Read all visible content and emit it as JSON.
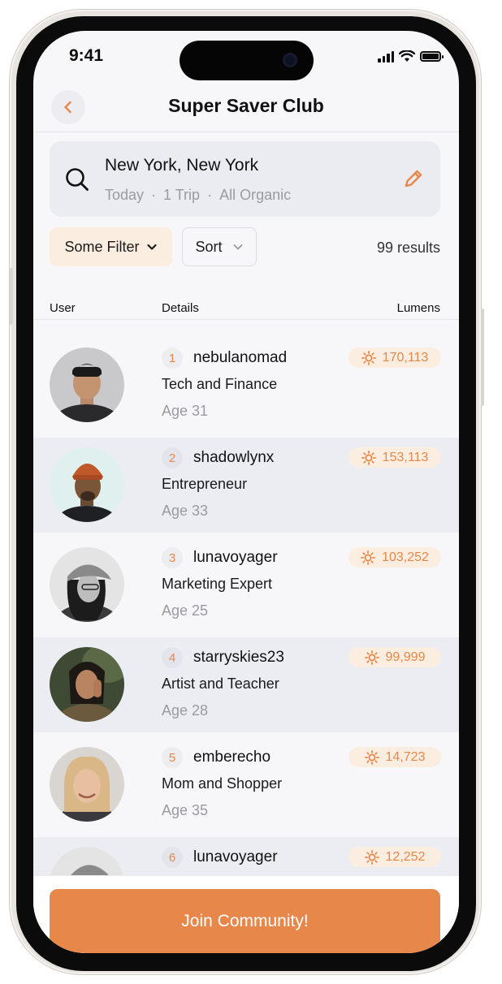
{
  "status_bar": {
    "time": "9:41"
  },
  "header": {
    "title": "Super Saver Club"
  },
  "search": {
    "location": "New York, New York",
    "meta": [
      "Today",
      "1 Trip",
      "All Organic"
    ]
  },
  "filters": {
    "filter_label": "Some Filter",
    "sort_label": "Sort",
    "results": "99 results"
  },
  "columns": {
    "user": "User",
    "details": "Details",
    "lumens": "Lumens"
  },
  "users": [
    {
      "rank": "1",
      "username": "nebulanomad",
      "details": "Tech and Finance",
      "age": "Age 31",
      "lumens": "170,113"
    },
    {
      "rank": "2",
      "username": "shadowlynx",
      "details": "Entrepreneur",
      "age": "Age 33",
      "lumens": "153,113"
    },
    {
      "rank": "3",
      "username": "lunavoyager",
      "details": "Marketing Expert",
      "age": "Age 25",
      "lumens": "103,252"
    },
    {
      "rank": "4",
      "username": "starryskies23",
      "details": "Artist and Teacher",
      "age": "Age 28",
      "lumens": "99,999"
    },
    {
      "rank": "5",
      "username": "emberecho",
      "details": "Mom and Shopper",
      "age": "Age 35",
      "lumens": "14,723"
    },
    {
      "rank": "6",
      "username": "lunavoyager",
      "details": "",
      "age": "",
      "lumens": "12,252"
    }
  ],
  "footer": {
    "cta_label": "Join Community!"
  },
  "colors": {
    "accent": "#e8874a",
    "accent_light": "#fbeee0",
    "background": "#f7f7fa"
  }
}
